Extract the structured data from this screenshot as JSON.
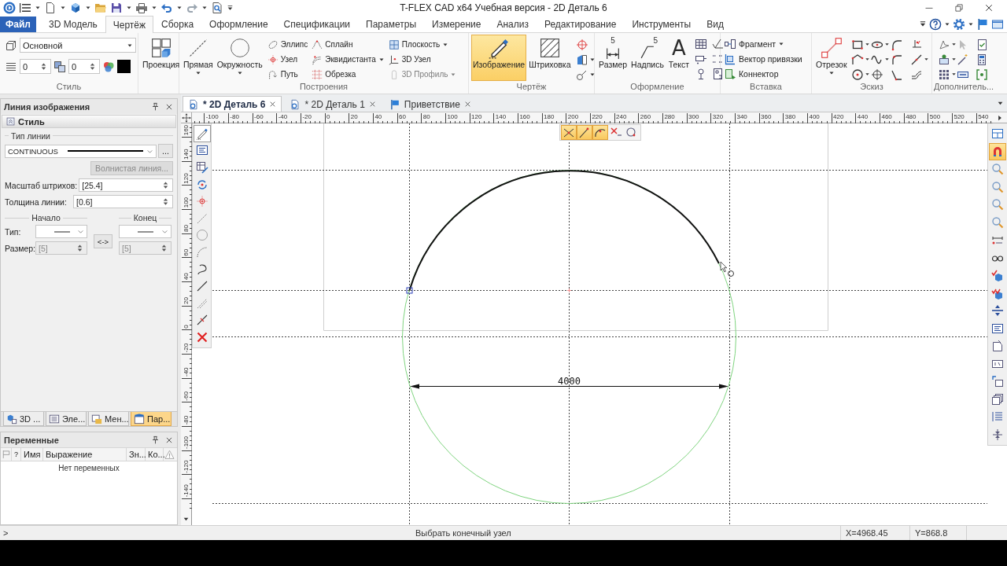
{
  "title_bar": {
    "title": "T-FLEX CAD x64 Учебная версия - 2D Деталь 6"
  },
  "menu": {
    "file_button": "Файл",
    "tabs": [
      {
        "label": "3D Модель",
        "selected": false
      },
      {
        "label": "Чертёж",
        "selected": true
      },
      {
        "label": "Сборка",
        "selected": false
      },
      {
        "label": "Оформление",
        "selected": false
      },
      {
        "label": "Спецификации",
        "selected": false
      },
      {
        "label": "Параметры",
        "selected": false
      },
      {
        "label": "Измерение",
        "selected": false
      },
      {
        "label": "Анализ",
        "selected": false
      },
      {
        "label": "Редактирование",
        "selected": false
      },
      {
        "label": "Инструменты",
        "selected": false
      },
      {
        "label": "Вид",
        "selected": false
      }
    ]
  },
  "ribbon": {
    "style": {
      "label": "Стиль",
      "layer": "Основной",
      "spinner_1": "0",
      "spinner_2": "0"
    },
    "projection": {
      "button": "Проекция"
    },
    "construction": {
      "label": "Построения",
      "large": [
        {
          "label": "Прямая",
          "dropdown": true
        },
        {
          "label": "Окружность",
          "dropdown": true
        }
      ],
      "small": [
        {
          "label": "Эллипс",
          "dropdown": false,
          "disabled": false
        },
        {
          "label": "Узел",
          "dropdown": false,
          "disabled": false
        },
        {
          "label": "Путь",
          "dropdown": false,
          "disabled": false
        },
        {
          "label": "Сплайн",
          "dropdown": false,
          "disabled": false
        },
        {
          "label": "Эквидистанта",
          "dropdown": true,
          "disabled": false
        },
        {
          "label": "Обрезка",
          "dropdown": false,
          "disabled": false
        },
        {
          "label": "Плоскость",
          "dropdown": true,
          "disabled": false
        },
        {
          "label": "3D Узел",
          "dropdown": false,
          "disabled": false
        },
        {
          "label": "3D Профиль",
          "dropdown": true,
          "disabled": true
        }
      ]
    },
    "drawing": {
      "label": "Чертёж",
      "large": [
        {
          "label": "Изображение",
          "selected": true
        },
        {
          "label": "Штриховка",
          "selected": false
        }
      ]
    },
    "annotation": {
      "label": "Оформление",
      "large": [
        {
          "label": "Размер",
          "kind": "dimension",
          "glyph": "5"
        },
        {
          "label": "Надпись",
          "kind": "leader",
          "glyph": "5"
        },
        {
          "label": "Текст",
          "kind": "letter",
          "glyph": "A"
        }
      ]
    },
    "insert": {
      "label": "Вставка",
      "items": [
        {
          "label": "Фрагмент",
          "dropdown": true
        },
        {
          "label": "Вектор привязки",
          "dropdown": false
        },
        {
          "label": "Коннектор",
          "dropdown": false
        }
      ]
    },
    "sketch": {
      "label": "Эскиз",
      "segment_button": {
        "label": "Отрезок",
        "dropdown": true
      }
    },
    "extra": {
      "label": "Дополнитель..."
    }
  },
  "properties_panel": {
    "title": "Линия изображения",
    "section": "Стиль",
    "line_type": {
      "legend": "Тип линии",
      "value": "CONTINUOUS",
      "more_button": "..."
    },
    "wavy_line_button": {
      "label": "Волнистая линия...",
      "disabled": true
    },
    "fields": [
      {
        "label": "Масштаб штрихов:",
        "value": "[25.4]"
      },
      {
        "label": "Толщина линии:",
        "value": "[0.6]"
      }
    ],
    "line_ends": {
      "start_heading": "Начало",
      "end_heading": "Конец",
      "type_label": "Тип:",
      "swap_button": "<->",
      "size_label": "Размер:",
      "start_size": "[5]",
      "end_size": "[5]",
      "size_disabled": true
    },
    "tabs": [
      {
        "label": "3D ...",
        "selected": false
      },
      {
        "label": "Эле...",
        "selected": false
      },
      {
        "label": "Мен...",
        "selected": false
      },
      {
        "label": "Пар...",
        "selected": true
      }
    ]
  },
  "variables_panel": {
    "title": "Переменные",
    "columns": [
      "?",
      "Имя",
      "Выражение",
      "Зн...",
      "Ко..."
    ],
    "empty_message": "Нет переменных"
  },
  "document_tabs": [
    {
      "label": "* 2D Деталь 6",
      "kind": "document",
      "selected": true
    },
    {
      "label": "* 2D Деталь 1",
      "kind": "document",
      "selected": false
    },
    {
      "label": "Приветствие",
      "kind": "welcome",
      "selected": false
    }
  ],
  "horizontal_ruler": {
    "labels": [
      "-100",
      "-80",
      "-60",
      "-40",
      "-20",
      "0",
      "20",
      "40",
      "60",
      "80",
      "100",
      "120",
      "140",
      "160",
      "180",
      "200",
      "220",
      "240",
      "260",
      "280",
      "300",
      "320",
      "340",
      "360",
      "380",
      "400",
      "420",
      "440",
      "460",
      "480",
      "500",
      "520",
      "540"
    ]
  },
  "vertical_ruler": {
    "labels": [
      "160",
      "140",
      "120",
      "100",
      "80",
      "60",
      "40",
      "20",
      "0",
      "-20",
      "-40",
      "-60",
      "-80",
      "-100",
      "-120",
      "-140"
    ]
  },
  "drawing_toolbar": [
    {
      "on": true
    },
    {
      "on": false
    },
    {
      "on": false
    },
    {
      "on": false
    },
    {
      "on": false
    },
    {
      "on": false
    },
    {
      "on": false
    },
    {
      "on": false
    },
    {
      "on": false
    },
    {
      "on": false
    },
    {
      "on": false
    },
    {
      "on": false
    },
    {
      "on": false
    }
  ],
  "snap_toolbar": [
    {
      "on": true
    },
    {
      "on": true
    },
    {
      "on": true
    },
    {
      "on": false
    },
    {
      "on": false
    }
  ],
  "view_toolbar": [
    {
      "on": false
    },
    {
      "on": true
    },
    {
      "on": false
    },
    {
      "on": false
    },
    {
      "on": false
    },
    {
      "on": false
    },
    {
      "on": false
    },
    {
      "on": false
    },
    {
      "on": false
    },
    {
      "on": false
    },
    {
      "on": false
    },
    {
      "on": false
    },
    {
      "on": false
    },
    {
      "on": false
    },
    {
      "on": false
    },
    {
      "on": false
    },
    {
      "on": false
    },
    {
      "on": false
    }
  ],
  "canvas": {
    "dimension_text": "4000"
  },
  "status_bar": {
    "prompt": ">",
    "message": "Выбрать конечный узел",
    "x_coordinate": "X=4968.45",
    "y_coordinate": "Y=868.8"
  }
}
